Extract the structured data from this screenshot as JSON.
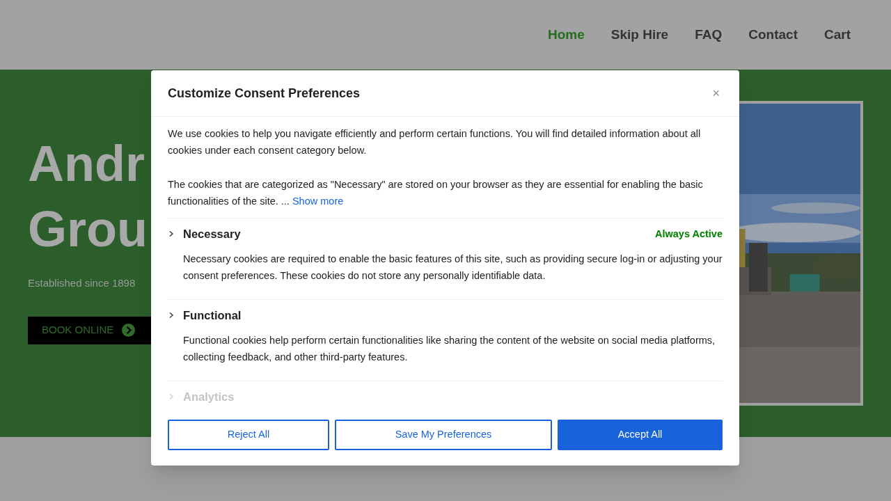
{
  "nav": [
    {
      "label": "Home",
      "selected": true
    },
    {
      "label": "Skip Hire",
      "selected": false
    },
    {
      "label": "FAQ",
      "selected": false
    },
    {
      "label": "Contact",
      "selected": false
    },
    {
      "label": "Cart",
      "selected": false
    }
  ],
  "hero": {
    "title_lines": [
      "Andr",
      "Grou"
    ],
    "subtitle": "Established since 1898",
    "button": "BOOK ONLINE"
  },
  "dialog": {
    "title": "Customize Consent Preferences",
    "close": "×",
    "intro": [
      "We use cookies to help you navigate efficiently and perform certain functions. You will find detailed information about all cookies under each consent category below.",
      "The cookies that are categorized as \"Necessary\" are stored on your browser as they are essential for enabling the basic functionalities of the site. ..."
    ],
    "show_more": "Show more",
    "categories": [
      {
        "name": "Necessary",
        "status": "Always Active",
        "description": "Necessary cookies are required to enable the basic features of this site, such as providing secure log-in or adjusting your consent preferences. These cookies do not store any personally identifiable data.",
        "faded": false
      },
      {
        "name": "Functional",
        "description": "Functional cookies help perform certain functionalities like sharing the content of the website on social media platforms, collecting feedback, and other third-party features.",
        "faded": false
      },
      {
        "name": "Analytics",
        "faded": true
      }
    ],
    "buttons": [
      {
        "label": "Reject All",
        "kind": "outline"
      },
      {
        "label": "Save My Preferences",
        "kind": "outline"
      },
      {
        "label": "Accept All",
        "kind": "primary"
      }
    ]
  }
}
